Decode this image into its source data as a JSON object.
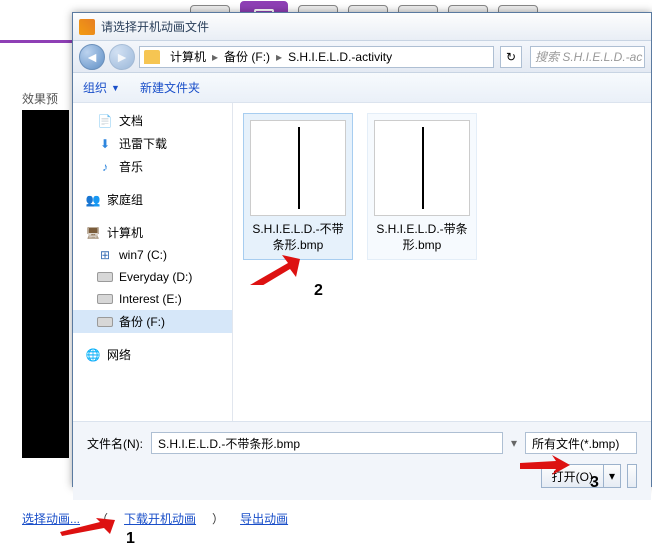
{
  "bg": {
    "effect_label": "效果预",
    "link_select": "选择动画...",
    "paren_open": "（",
    "link_download": "下载开机动画",
    "paren_close": "）",
    "link_export": "导出动画"
  },
  "dialog": {
    "title": "请选择开机动画文件",
    "breadcrumb": [
      "计算机",
      "备份 (F:)",
      "S.H.I.E.L.D.-activity"
    ],
    "search_placeholder": "搜索 S.H.I.E.L.D.-ac",
    "toolbar": {
      "organize": "组织",
      "newfolder": "新建文件夹"
    },
    "nav": {
      "docs": "文档",
      "xunlei": "迅雷下载",
      "music": "音乐",
      "homegroup": "家庭组",
      "computer": "计算机",
      "drives": [
        "win7 (C:)",
        "Everyday (D:)",
        "Interest (E:)",
        "备份 (F:)"
      ],
      "network": "网络"
    },
    "files": [
      {
        "name": "S.H.I.E.L.D.-不带条形.bmp",
        "selected": true
      },
      {
        "name": "S.H.I.E.L.D.-带条形.bmp",
        "selected": false
      }
    ],
    "filename_label": "文件名(N):",
    "filename_value": "S.H.I.E.L.D.-不带条形.bmp",
    "filter": "所有文件(*.bmp)",
    "open": "打开(O)"
  },
  "annotations": {
    "n1": "1",
    "n2": "2",
    "n3": "3"
  }
}
